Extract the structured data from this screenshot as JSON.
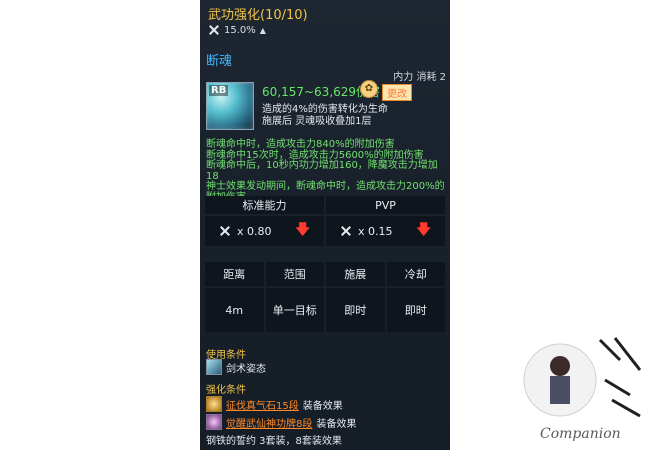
{
  "header": {
    "title": "武功强化(10/10)",
    "stat": "15.0%",
    "stat_arrow": "▲"
  },
  "skill": {
    "name": "断魂",
    "cost": "内力 消耗 2",
    "icon_badge": "RB",
    "damage": "60,157~63,629伤害",
    "change_label": "更改",
    "effect_lines": [
      "造成的4%的伤害转化为生命",
      "施展后 灵魂吸收叠加1层"
    ]
  },
  "green_text": [
    "断魂命中时，造成攻击力840%的附加伤害",
    "断魂命中15次时，造成攻击力5600%的附加伤害",
    "断魂命中后，10秒内功力增加160，降魔攻击力增加18",
    "神士效果发动期间，断魂命中时，造成攻击力200%的",
    "附加伤害"
  ],
  "stats_table": {
    "headers": [
      "标准能力",
      "PVP"
    ],
    "values": [
      "x 0.80",
      "x 0.15"
    ],
    "arrow": "🡇"
  },
  "info_table": {
    "headers": [
      "距离",
      "范围",
      "施展",
      "冷却"
    ],
    "values": [
      "4m",
      "单一目标",
      "即时",
      "即时"
    ]
  },
  "conditions": {
    "use_label": "使用条件",
    "use_item": "剑术姿态",
    "enhance_label": "强化条件",
    "enhance_items": [
      {
        "link": "征伐真气石15段",
        "suffix": "装备效果"
      },
      {
        "link": "觉醒武仙神功牌8段",
        "suffix": "装备效果"
      }
    ],
    "last_line": "钢铁的誓约 3套装，8套装效果"
  },
  "watermark": {
    "text": "Companion"
  }
}
